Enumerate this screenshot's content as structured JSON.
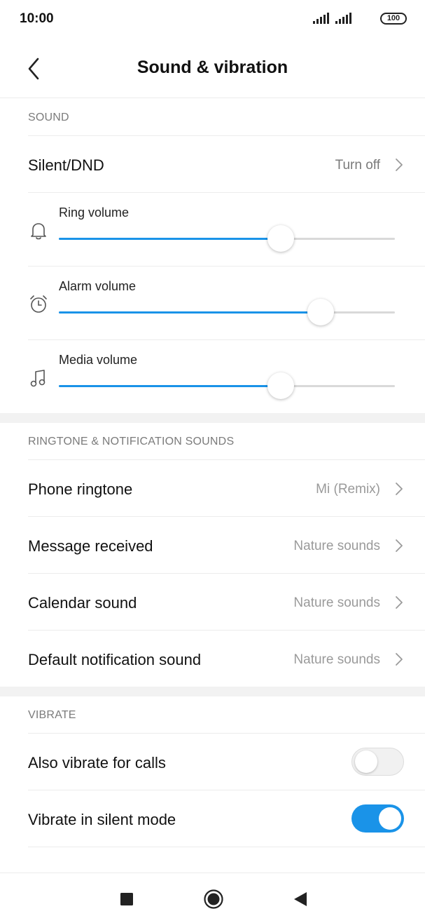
{
  "status_bar": {
    "time": "10:00",
    "battery": "100"
  },
  "header": {
    "title": "Sound & vibration"
  },
  "sound": {
    "section_label": "SOUND",
    "silent_dnd": {
      "label": "Silent/DND",
      "value": "Turn off"
    },
    "sliders": [
      {
        "label": "Ring volume",
        "icon": "bell-icon",
        "level": 0.66
      },
      {
        "label": "Alarm volume",
        "icon": "alarm-clock-icon",
        "level": 0.78
      },
      {
        "label": "Media volume",
        "icon": "music-note-icon",
        "level": 0.66
      }
    ]
  },
  "ringtones": {
    "section_label": "RINGTONE & NOTIFICATION SOUNDS",
    "items": [
      {
        "label": "Phone ringtone",
        "value": "Mi (Remix)"
      },
      {
        "label": "Message received",
        "value": "Nature sounds"
      },
      {
        "label": "Calendar sound",
        "value": "Nature sounds"
      },
      {
        "label": "Default notification sound",
        "value": "Nature sounds"
      }
    ]
  },
  "vibrate": {
    "section_label": "VIBRATE",
    "toggles": [
      {
        "label": "Also vibrate for calls",
        "on": false
      },
      {
        "label": "Vibrate in silent mode",
        "on": true
      }
    ]
  },
  "colors": {
    "accent": "#1a93e8",
    "track": "#d9d9d9",
    "section_gap": "#f2f2f2"
  }
}
